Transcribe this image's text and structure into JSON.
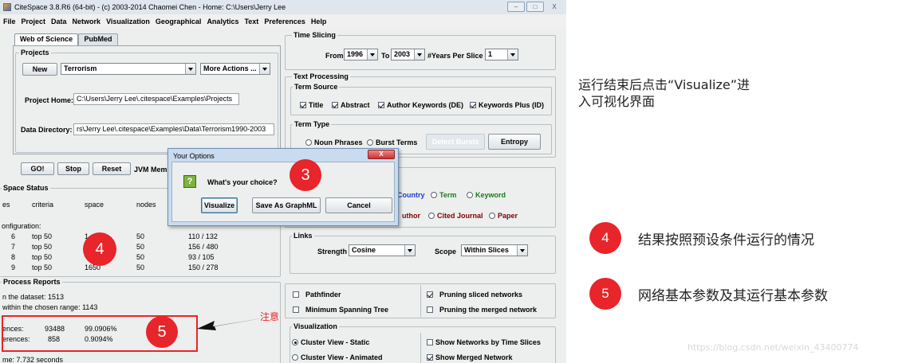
{
  "window": {
    "title": "CiteSpace 3.8.R6 (64-bit) - (c) 2003-2014 Chaomei Chen - Home: C:\\Users\\Jerry Lee",
    "controls": [
      "–",
      "□",
      "X"
    ]
  },
  "menu": [
    "File",
    "Project",
    "Data",
    "Network",
    "Visualization",
    "Geographical",
    "Analytics",
    "Text",
    "Preferences",
    "Help"
  ],
  "tabs": {
    "wos": "Web of Science",
    "pubmed": "PubMed"
  },
  "projects": {
    "legend": "Projects",
    "new_label": "New",
    "project_value": "Terrorism",
    "more_actions": "More Actions ...",
    "home_label": "Project Home:",
    "home_value": "C:\\Users\\Jerry Lee\\.citespace\\Examples\\Projects",
    "data_label": "Data Directory:",
    "data_value": "rs\\Jerry Lee\\.citespace\\Examples\\Data\\Terrorism1990-2003"
  },
  "controls": {
    "go": "GO!",
    "stop": "Stop",
    "reset": "Reset",
    "jvm": "JVM Mem"
  },
  "status": {
    "legend": "Space Status",
    "headers": [
      "es",
      "criteria",
      "space",
      "nodes"
    ],
    "config": "onfiguration:",
    "rows": [
      {
        "a": "6",
        "b": "top 50",
        "c": "1",
        "d": "50",
        "e": "110 / 132"
      },
      {
        "a": "7",
        "b": "top 50",
        "c": "",
        "d": "50",
        "e": "156 / 480"
      },
      {
        "a": "8",
        "b": "top 50",
        "c": "",
        "d": "50",
        "e": "93 / 105"
      },
      {
        "a": "9",
        "b": "top 50",
        "c": "1650",
        "d": "50",
        "e": "150 / 278"
      }
    ]
  },
  "process": {
    "legend": "Process Reports",
    "line1": "n the dataset: 1513",
    "line2": "within the chosen range: 1143",
    "r1_label": "ences:",
    "r1_val": "93488",
    "r1_pct": "99.0906%",
    "r2_label": "erences:",
    "r2_val": "858",
    "r2_pct": "0.9094%",
    "time": "me:  7.732 seconds"
  },
  "time_slicing": {
    "legend": "Time Slicing",
    "from_label": "From",
    "from_value": "1996",
    "to_label": "To",
    "to_value": "2003",
    "years_label": "#Years Per Slice",
    "years_value": "1"
  },
  "text_processing": {
    "legend": "Text Processing",
    "term_source_legend": "Term Source",
    "sources": [
      "Title",
      "Abstract",
      "Author Keywords (DE)",
      "Keywords Plus (ID)"
    ],
    "term_type_legend": "Term Type",
    "noun_phrases": "Noun Phrases",
    "burst_terms": "Burst Terms",
    "detect_bursts": "Detect Bursts",
    "entropy": "Entropy"
  },
  "node_types": {
    "country": "Country",
    "term": "Term",
    "keyword": "Keyword",
    "author": "uthor",
    "cited_journal": "Cited Journal",
    "paper": "Paper"
  },
  "links": {
    "legend": "Links",
    "strength_label": "Strength",
    "strength_value": "Cosine",
    "scope_label": "Scope",
    "scope_value": "Within Slices"
  },
  "pruning": {
    "pathfinder": "Pathfinder",
    "mst": "Minimum Spanning Tree",
    "sliced": "Pruning sliced networks",
    "merged": "Pruning the merged network"
  },
  "visualization": {
    "legend": "Visualization",
    "static": "Cluster View - Static",
    "animated": "Cluster View - Animated",
    "by_slices": "Show Networks by Time Slices",
    "merged": "Show Merged Network"
  },
  "dialog": {
    "title": "Your Options",
    "question": "What's your choice?",
    "visualize": "Visualize",
    "save_graphml": "Save As GraphML",
    "cancel": "Cancel",
    "close": "X"
  },
  "annotations": {
    "circle3": "3",
    "circle4": "4",
    "circle5": "5",
    "attention": "注意",
    "instruction_line1": "运行结束后点击“Visualize”进",
    "instruction_line2": "入可视化界面",
    "legend4_num": "4",
    "legend4_text": "结果按照预设条件运行的情况",
    "legend5_num": "5",
    "legend5_text": "网络基本参数及其运行基本参数",
    "watermark": "https://blog.csdn.net/weixin_43400774"
  },
  "colors": {
    "highlight": "#e8252a",
    "green_text": "#1a7a1a",
    "blue_text": "#1a3fd0",
    "maroon_text": "#800000"
  }
}
